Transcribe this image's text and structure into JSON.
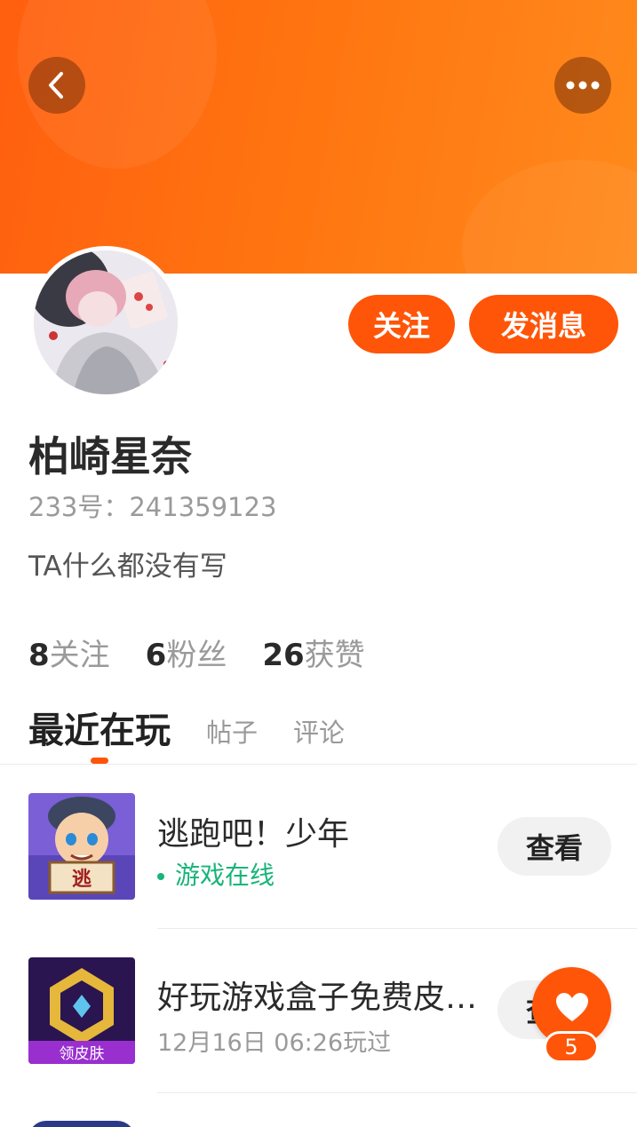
{
  "header": {
    "back_icon": "chevron-left-icon",
    "more_icon": "more-dots-icon"
  },
  "profile": {
    "name": "柏崎星奈",
    "id_label": "233号：241359123",
    "bio": "TA什么都没有写",
    "follow_label": "关注",
    "message_label": "发消息"
  },
  "stats": [
    {
      "num": "8",
      "label": "关注"
    },
    {
      "num": "6",
      "label": "粉丝"
    },
    {
      "num": "26",
      "label": "获赞"
    }
  ],
  "tabs": [
    {
      "label": "最近在玩"
    },
    {
      "label": "帖子"
    },
    {
      "label": "评论"
    }
  ],
  "games": [
    {
      "title": "逃跑吧！少年",
      "status": "游戏在线",
      "button": "查看",
      "icon_text": "逃"
    },
    {
      "title": "好玩游戏盒子免费皮…",
      "time": "12月16日 06:26玩过",
      "button": "查看",
      "icon_text": "领皮肤"
    }
  ],
  "like_fab": {
    "icon": "heart-icon",
    "count": "5"
  },
  "colors": {
    "accent": "#ff5508",
    "online": "#19b47a"
  }
}
